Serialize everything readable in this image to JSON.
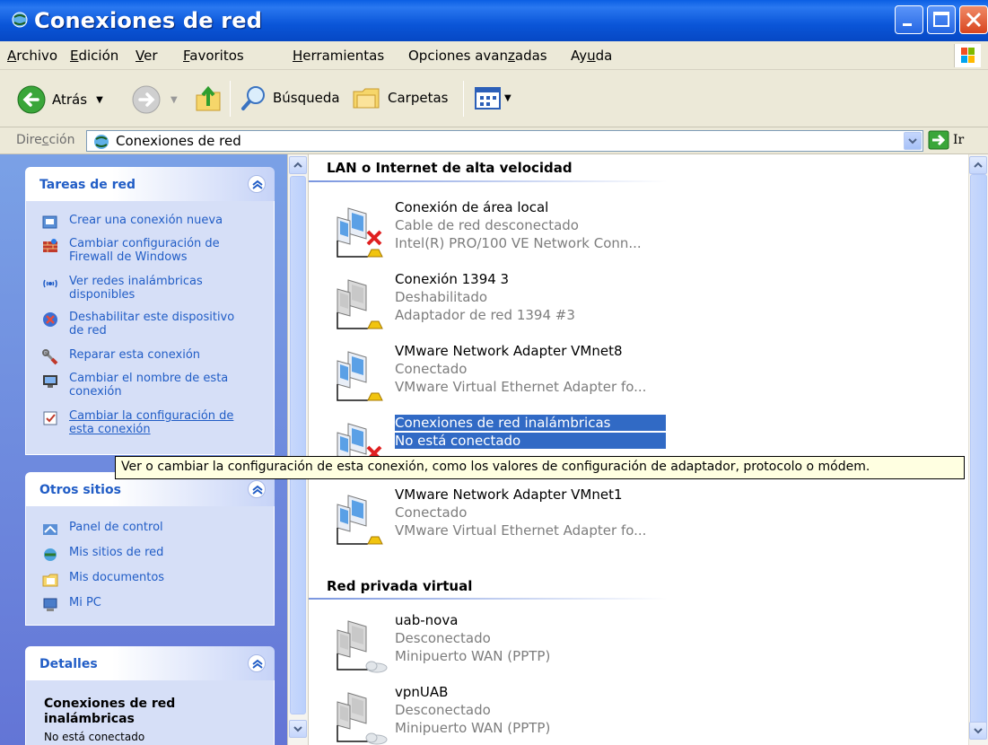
{
  "window": {
    "title": "Conexiones de red"
  },
  "menu": [
    {
      "pre": "",
      "u": "A",
      "post": "rchivo"
    },
    {
      "pre": "",
      "u": "E",
      "post": "dición"
    },
    {
      "pre": "",
      "u": "V",
      "post": "er"
    },
    {
      "pre": "",
      "u": "F",
      "post": "avoritos"
    },
    {
      "pre": "",
      "u": "H",
      "post": "erramientas"
    },
    {
      "pre": "Opciones avan",
      "u": "z",
      "post": "adas"
    },
    {
      "pre": "Ay",
      "u": "u",
      "post": "da"
    }
  ],
  "toolbar": {
    "back": "Atrás",
    "search": "Búsqueda",
    "folders": "Carpetas"
  },
  "address": {
    "label": "Dirección",
    "value": "Conexiones de red",
    "go": "Ir"
  },
  "tasks": {
    "title": "Tareas de red",
    "items": [
      {
        "label": "Crear una conexión nueva",
        "icon": "new-connection-icon"
      },
      {
        "label": "Cambiar configuración de Firewall de Windows",
        "icon": "firewall-icon"
      },
      {
        "label": "Ver redes inalámbricas disponibles",
        "icon": "wireless-icon"
      },
      {
        "label": "Deshabilitar este dispositivo de red",
        "icon": "disable-device-icon"
      },
      {
        "label": "Reparar esta conexión",
        "icon": "repair-icon"
      },
      {
        "label": "Cambiar el nombre de esta conexión",
        "icon": "rename-icon"
      },
      {
        "label": "Cambiar la configuración de esta conexión",
        "icon": "properties-icon"
      }
    ]
  },
  "other_places": {
    "title": "Otros sitios",
    "items": [
      {
        "label": "Panel de control",
        "icon": "control-panel-icon"
      },
      {
        "label": "Mis sitios de red",
        "icon": "network-places-icon"
      },
      {
        "label": "Mis documentos",
        "icon": "my-documents-icon"
      },
      {
        "label": "Mi PC",
        "icon": "my-computer-icon"
      }
    ]
  },
  "details": {
    "title": "Detalles",
    "name": "Conexiones de red inalámbricas",
    "status": "No está conectado"
  },
  "groups": {
    "lan": "LAN o Internet de alta velocidad",
    "vpn": "Red privada virtual"
  },
  "connections": [
    {
      "name": "Conexión de área local",
      "status": "Cable de red desconectado",
      "device": "Intel(R) PRO/100 VE Network Conn...",
      "state": "disconnected"
    },
    {
      "name": "Conexión 1394 3",
      "status": "Deshabilitado",
      "device": "Adaptador de red 1394 #3",
      "state": "disabled"
    },
    {
      "name": "VMware Network Adapter VMnet8",
      "status": "Conectado",
      "device": "VMware Virtual Ethernet Adapter fo...",
      "state": "connected"
    },
    {
      "name": "Conexiones de red inalámbricas",
      "status": "No está conectado",
      "device": "",
      "state": "disconnected-selected"
    },
    {
      "name": "VMware Network Adapter VMnet1",
      "status": "Conectado",
      "device": "VMware Virtual Ethernet Adapter fo...",
      "state": "connected"
    },
    {
      "name": "uab-nova",
      "status": "Desconectado",
      "device": "Minipuerto WAN (PPTP)",
      "state": "vpn"
    },
    {
      "name": "vpnUAB",
      "status": "Desconectado",
      "device": "Minipuerto WAN (PPTP)",
      "state": "vpn"
    }
  ],
  "tooltip": "Ver o cambiar la configuración de esta conexión, como los valores de configuración de adaptador, protocolo o módem."
}
